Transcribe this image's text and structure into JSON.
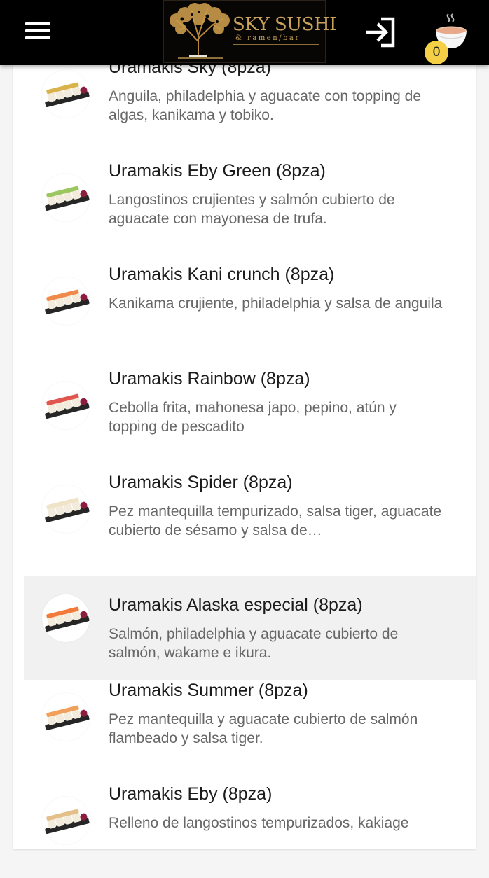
{
  "header": {
    "logo": {
      "name": "SKY SUSHI",
      "subtitle": "& ramen/bar"
    },
    "cart_count": "0"
  },
  "menu_items": [
    {
      "title": "Uramakis Sky (8pza)",
      "description": "Anguila, philadelphia y aguacate con topping de algas, kanikama y tobiko.",
      "topping_color": "#d9b24a"
    },
    {
      "title": "Uramakis Eby Green (8pza)",
      "description": "Langostinos crujientes y salmón cubierto de aguacate con mayonesa de trufa.",
      "topping_color": "#9bc760"
    },
    {
      "title": "Uramakis Kani crunch (8pza)",
      "description": "Kanikama crujiente, philadelphia y salsa de anguila",
      "topping_color": "#f08a4b"
    },
    {
      "title": "Uramakis Rainbow (8pza)",
      "description": "Cebolla frita, mahonesa japo, pepino, atún y topping de pescadito",
      "topping_color": "#e0564f"
    },
    {
      "title": "Uramakis Spider (8pza)",
      "description": "Pez mantequilla tempurizado, salsa tiger, aguacate cubierto de sésamo y salsa de…",
      "topping_color": "#efe4c8"
    },
    {
      "title": "Uramakis Alaska especial (8pza)",
      "description": "Salmón, philadelphia y aguacate cubierto de salmón, wakame e ikura.",
      "topping_color": "#f27a3a"
    },
    {
      "title": "Uramakis Summer (8pza)",
      "description": "Pez mantequilla y aguacate cubierto de salmón flambeado y salsa tiger.",
      "topping_color": "#f0a05b"
    },
    {
      "title": "Uramakis Eby (8pza)",
      "description": "Relleno de langostinos tempurizados, kakiage",
      "topping_color": "#e3c08a"
    }
  ]
}
